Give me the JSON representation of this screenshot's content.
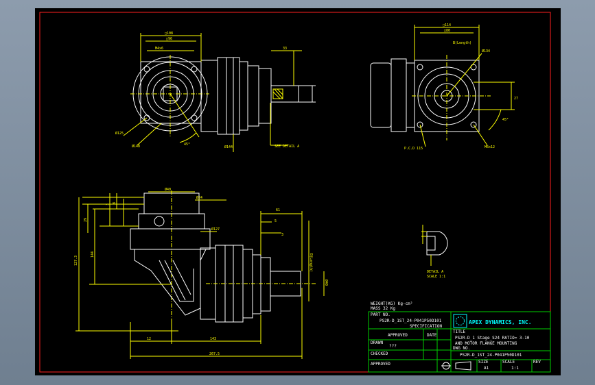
{
  "dims": {
    "d108": "□108",
    "d96": "□96",
    "d80": "□80",
    "d114": "□114",
    "d134": "Ø134",
    "d125": "Ø125",
    "d148": "Ø148",
    "d144": "Ø144",
    "d24": "Ø24",
    "d40": "Ø40",
    "d127": "Ø127",
    "d40b": "Ø40",
    "a45": "45°",
    "a45b": "45°",
    "v33": "33",
    "v27": "27",
    "v8": "8",
    "v61": "61",
    "v5": "5",
    "v3": "3",
    "v29": "29",
    "v3b": "3",
    "v144": "144",
    "v1273": "127.3",
    "v143": "143",
    "v2675": "267.5",
    "v12": "12",
    "b_len": "B(Length)",
    "m4": "M4x6",
    "m6": "M6x12",
    "pcd": "P.C.D 115",
    "seedetail": "SEE DETAIL A",
    "detaila": "DETAIL A",
    "scale": "SCALE 1:1"
  },
  "block": {
    "mass_label": "WEIGHT(KG) Kg-cm²",
    "mass_value": "MASS 32 Kg",
    "part_no_label": "PART NO.",
    "part_no": "PS2R-D_1ST_24-P041P50D101",
    "spec": "SPECIFICATION",
    "approved": "APPROVED",
    "date": "DATE",
    "drawn": "DRAWN",
    "drawn_val": "???",
    "checked": "CHECKED",
    "approved2": "APPROVED",
    "company": "APEX DYNAMICS, INC.",
    "title_label": "TITLE",
    "title1": "PS2R-D_1 Stage_S24   RATIO= 3-10",
    "title2": "AND MOTOR FLANGE MOUNTING",
    "dwg_label": "DWG NO.",
    "dwg_no": "PS2R-D_1ST_24-P041P50D101",
    "size_label": "SIZE",
    "size": "A1",
    "scale_label": "SCALE",
    "scale": "1:1",
    "rev_label": "REV"
  },
  "colors": {
    "sheet": "#000000",
    "border": "#ff2020",
    "dims": "#ffff00",
    "lines": "#ffffff",
    "block": "#00d000",
    "logo": "#00ffff"
  }
}
